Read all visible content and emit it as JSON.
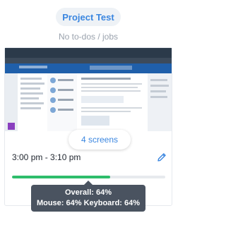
{
  "project": {
    "name": "Project Test"
  },
  "todos": {
    "text": "No to-dos / jobs"
  },
  "activity": {
    "screens_label": "4 screens",
    "time_range": "3:00 pm - 3:10 pm",
    "progress_percent": 64,
    "tooltip": {
      "overall": "Overall: 64%",
      "detail": "Mouse: 64% Keyboard: 64%"
    }
  },
  "colors": {
    "accent": "#3a86e0",
    "progress": "#2ebd6b",
    "tooltip_bg": "#4a5360"
  },
  "icons": {
    "edit": "pencil-icon"
  }
}
